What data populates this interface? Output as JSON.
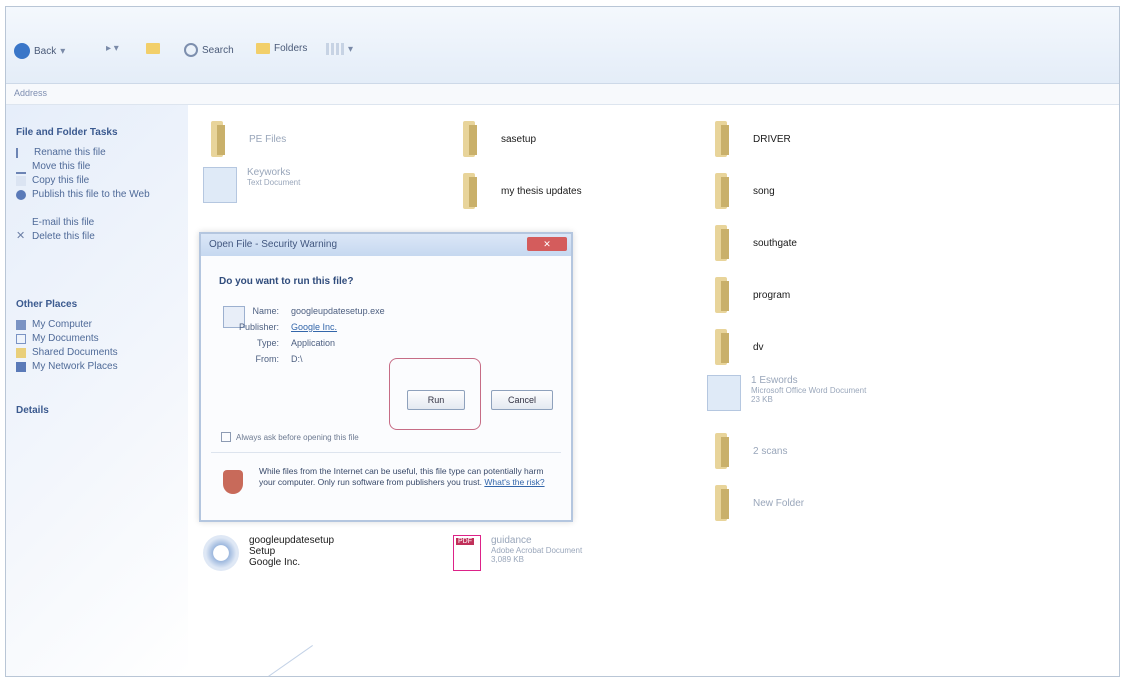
{
  "toolbar": {
    "back_label": "Back",
    "search_label": "Search",
    "folders_label": "Folders"
  },
  "address": {
    "label": "Address"
  },
  "sidebar": {
    "file_tasks_title": "File and Folder Tasks",
    "file_tasks": [
      {
        "label": "Rename this file",
        "icon": "rename-icon"
      },
      {
        "label": "Move this file",
        "icon": "move-icon"
      },
      {
        "label": "Copy this file",
        "icon": "copy-icon"
      },
      {
        "label": "Publish this file to the Web",
        "icon": "globe-icon"
      },
      {
        "label": "E-mail this file",
        "icon": "email-icon"
      },
      {
        "label": "Delete this file",
        "icon": "delete-icon"
      }
    ],
    "other_places_title": "Other Places",
    "other_places": [
      {
        "label": "My Computer",
        "icon": "computer-icon"
      },
      {
        "label": "My Documents",
        "icon": "documents-icon"
      },
      {
        "label": "Shared Documents",
        "icon": "shared-folder-icon"
      },
      {
        "label": "My Network Places",
        "icon": "network-icon"
      }
    ],
    "details_title": "Details"
  },
  "files": {
    "col1_top": "PE Files",
    "col1_second": "Keyworks",
    "col1_second_sub": "Text Document",
    "col2_row1": "sasetup",
    "col2_row2": "my thesis updates",
    "col2_row3": "...",
    "col3": [
      "DRIVER",
      "song",
      "southgate",
      "program",
      "dv"
    ],
    "col3_file": "1 Eswords",
    "col3_file_sub": "Microsoft Office Word Document",
    "col3_file_size": "23 KB",
    "col3_more": [
      "2 scans",
      "New Folder"
    ],
    "setup_name": "googleupdatesetup",
    "setup_line2": "Setup",
    "setup_line3": "Google Inc.",
    "pdf_name": "guidance",
    "pdf_sub": "Adobe Acrobat Document",
    "pdf_size": "3,089 KB"
  },
  "dialog": {
    "title": "Open File - Security Warning",
    "close_label": "Close",
    "question": "Do you want to run this file?",
    "name_label": "Name:",
    "name_value": "googleupdatesetup.exe",
    "publisher_label": "Publisher:",
    "publisher_value": "Google Inc.",
    "type_label": "Type:",
    "type_value": "Application",
    "from_label": "From:",
    "from_value": "D:\\",
    "run_label": "Run",
    "cancel_label": "Cancel",
    "checkbox_label": "Always ask before opening this file",
    "warning_text": "While files from the Internet can be useful, this file type can potentially harm your computer. Only run software from publishers you trust.",
    "warning_link": "What's the risk?"
  },
  "colors": {
    "highlight": "#c66c85",
    "folder": "#e8d49a"
  }
}
